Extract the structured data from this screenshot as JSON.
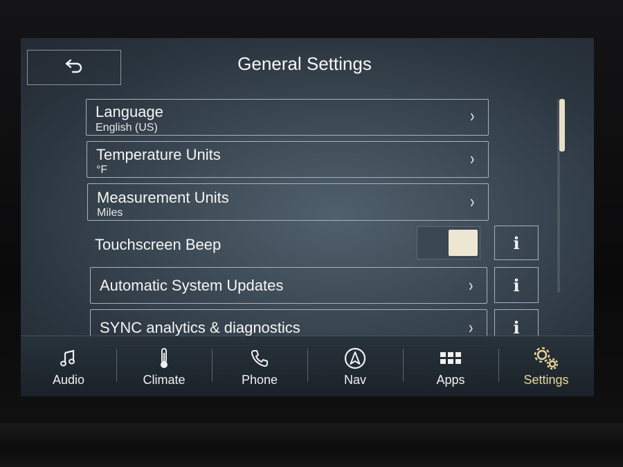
{
  "header": {
    "title": "General Settings",
    "back_icon": "back-arrow-icon"
  },
  "settings": {
    "items": [
      {
        "label": "Language",
        "value": "English (US)",
        "type": "link"
      },
      {
        "label": "Temperature Units",
        "value": "°F",
        "type": "link"
      },
      {
        "label": "Measurement Units",
        "value": "Miles",
        "type": "link"
      },
      {
        "label": "Touchscreen Beep",
        "type": "toggle",
        "state": "on"
      },
      {
        "label": "Automatic System Updates",
        "type": "link"
      },
      {
        "label": "SYNC analytics & diagnostics",
        "type": "link"
      }
    ],
    "info_glyph": "i",
    "chevron_glyph": "›"
  },
  "nav": {
    "items": [
      {
        "label": "Audio",
        "icon": "music-note-icon"
      },
      {
        "label": "Climate",
        "icon": "thermometer-icon"
      },
      {
        "label": "Phone",
        "icon": "phone-icon"
      },
      {
        "label": "Nav",
        "icon": "navigation-icon"
      },
      {
        "label": "Apps",
        "icon": "apps-grid-icon"
      },
      {
        "label": "Settings",
        "icon": "gears-icon",
        "active": true
      }
    ]
  },
  "colors": {
    "accent": "#ecd79a",
    "toggle_knob": "#ede6d2"
  }
}
